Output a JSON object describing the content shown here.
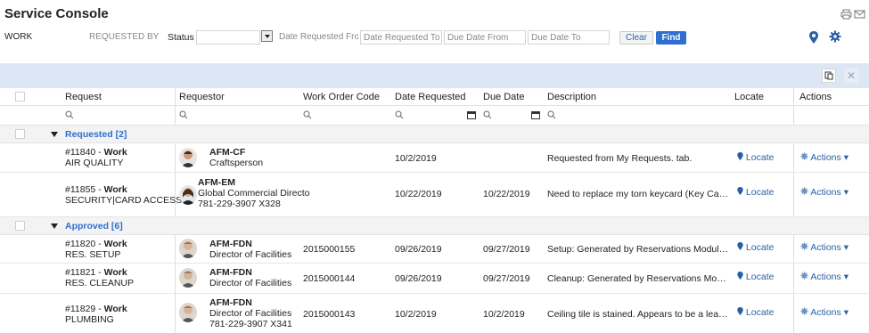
{
  "page": {
    "title": "Service Console"
  },
  "filters": {
    "work_value": "WORK",
    "requested_by_placeholder": "REQUESTED BY",
    "status_label": "Status",
    "date_from_placeholder": "Date Requested Fror",
    "date_to_placeholder": "Date Requested To",
    "due_from_placeholder": "Due Date From",
    "due_to_placeholder": "Due Date To",
    "clear_label": "Clear",
    "find_label": "Find"
  },
  "columns": {
    "request": "Request",
    "requestor": "Requestor",
    "work_order_code": "Work Order Code",
    "date_requested": "Date Requested",
    "due_date": "Due Date",
    "description": "Description",
    "locate": "Locate",
    "actions": "Actions"
  },
  "groups": [
    {
      "label": "Requested [2]",
      "rows": [
        {
          "number": "#11840",
          "type": "Work",
          "category": "AIR QUALITY",
          "requestor_code": "AFM-CF",
          "requestor_role": "Craftsperson",
          "requestor_phone": "",
          "wo_code": "",
          "date_requested": "10/2/2019",
          "due_date": "",
          "description": "Requested from My Requests. tab.",
          "locate": "Locate",
          "actions": "Actions"
        },
        {
          "number": "#11855",
          "type": "Work",
          "category": "SECURITY|CARD ACCESS",
          "requestor_code": "AFM-EM",
          "requestor_role": "Global Commercial Directo",
          "requestor_phone": "781-229-3907 X328",
          "wo_code": "",
          "date_requested": "10/22/2019",
          "due_date": "10/22/2019",
          "description": "Need to replace my torn keycard (Key Card)",
          "locate": "Locate",
          "actions": "Actions"
        }
      ]
    },
    {
      "label": "Approved [6]",
      "rows": [
        {
          "number": "#11820",
          "type": "Work",
          "category": "RES. SETUP",
          "requestor_code": "AFM-FDN",
          "requestor_role": "Director of Facilities",
          "requestor_phone": "",
          "wo_code": "2015000155",
          "date_requested": "09/26/2019",
          "due_date": "09/27/2019",
          "description": "Setup: Generated by Reservations Module. At...",
          "locate": "Locate",
          "actions": "Actions"
        },
        {
          "number": "#11821",
          "type": "Work",
          "category": "RES. CLEANUP",
          "requestor_code": "AFM-FDN",
          "requestor_role": "Director of Facilities",
          "requestor_phone": "",
          "wo_code": "2015000144",
          "date_requested": "09/26/2019",
          "due_date": "09/27/2019",
          "description": "Cleanup: Generated by Reservations Module. ...",
          "locate": "Locate",
          "actions": "Actions"
        },
        {
          "number": "#11829",
          "type": "Work",
          "category": "PLUMBING",
          "requestor_code": "AFM-FDN",
          "requestor_role": "Director of Facilities",
          "requestor_phone": "781-229-3907 X341",
          "wo_code": "2015000143",
          "date_requested": "10/2/2019",
          "due_date": "10/2/2019",
          "description": "Ceiling tile is stained. Appears to be a leak. N...",
          "locate": "Locate",
          "actions": "Actions"
        }
      ]
    }
  ],
  "colors": {
    "accent": "#2f6fcf",
    "band": "#dde6f4",
    "link": "#2a5fa6"
  }
}
